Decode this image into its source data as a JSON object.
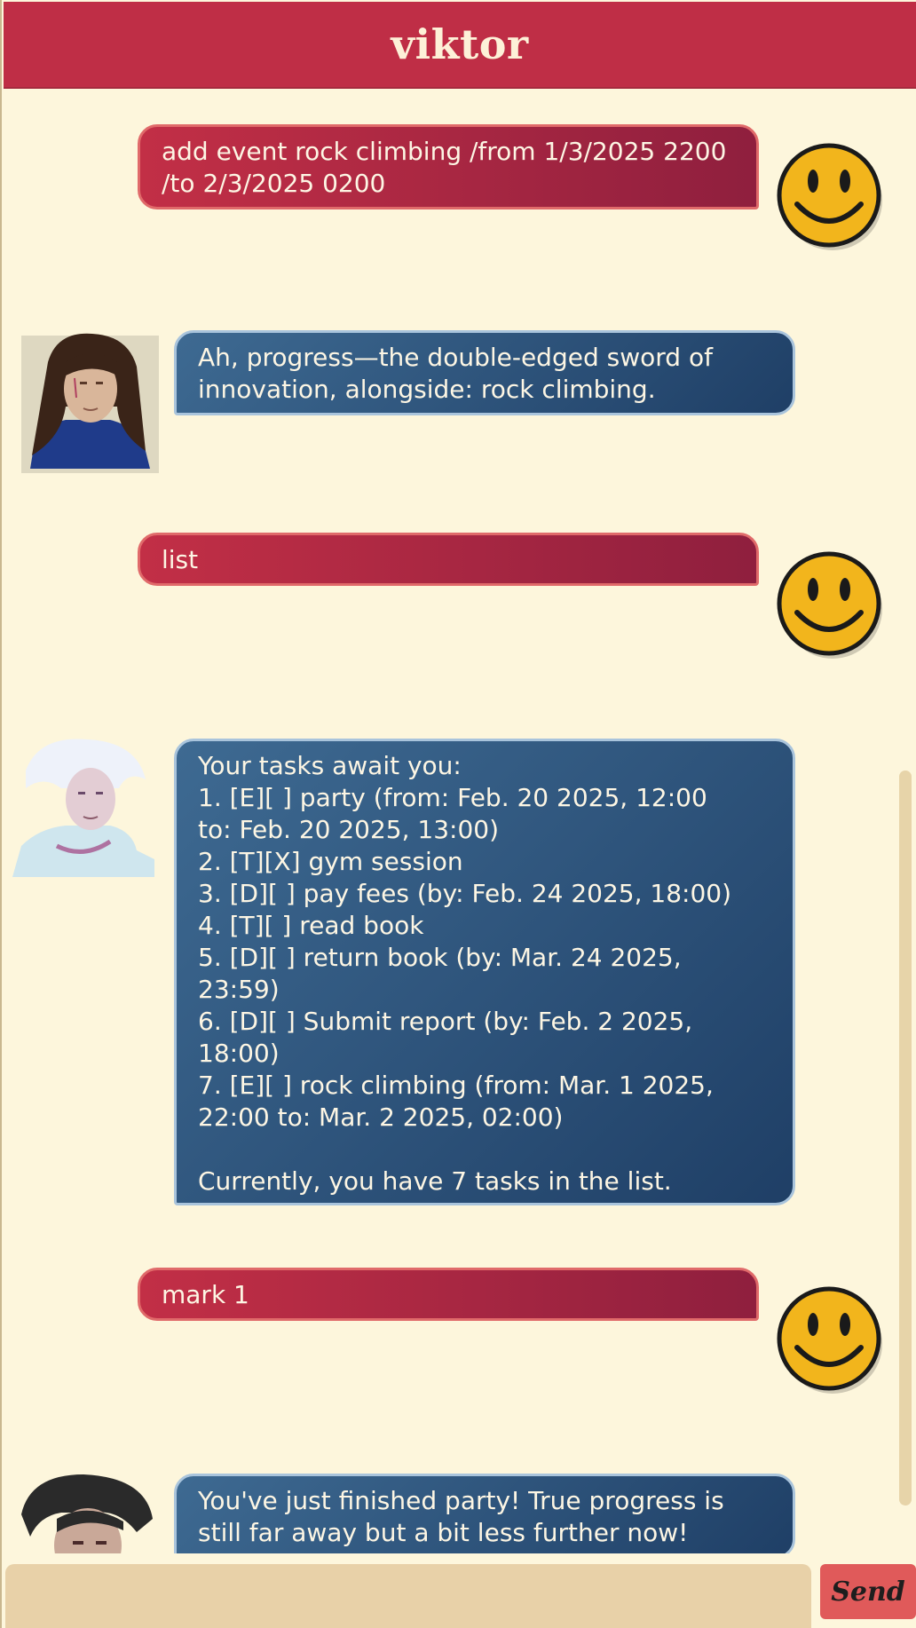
{
  "header": {
    "title": "viktor"
  },
  "messages": [
    {
      "role": "user",
      "text": "add event rock climbing /from 1/3/2025 2200\n/to 2/3/2025 0200"
    },
    {
      "role": "bot",
      "text": "Ah, progress—the double-edged sword of\ninnovation, alongside: rock climbing."
    },
    {
      "role": "user",
      "text": "list"
    },
    {
      "role": "bot",
      "text": "Your tasks await you:\n1. [E][ ] party (from: Feb. 20 2025, 12:00\nto: Feb. 20 2025, 13:00)\n2. [T][X] gym session\n3. [D][ ] pay fees (by: Feb. 24 2025, 18:00)\n4. [T][ ] read book\n5. [D][ ] return book (by: Mar. 24 2025,\n23:59)\n6. [D][ ] Submit report (by: Feb. 2 2025,\n18:00)\n7. [E][ ] rock climbing (from: Mar. 1 2025,\n22:00 to: Mar. 2 2025, 02:00)\n\nCurrently, you have 7 tasks in the list."
    },
    {
      "role": "user",
      "text": "mark 1"
    },
    {
      "role": "bot",
      "text": "You've just finished party! True progress is\nstill far away but a bit less further now!"
    }
  ],
  "input": {
    "value": "",
    "placeholder": ""
  },
  "send_button": {
    "label": "Send"
  },
  "colors": {
    "header": "#bf2e46",
    "user_bubble": "#b02a44",
    "bot_bubble": "#2c527c",
    "background": "#fdf6dc",
    "send_button": "#e05a5a"
  },
  "icons": {
    "user_avatar": "smiley-face-icon",
    "bot_avatar": "viktor-portrait-icon"
  }
}
